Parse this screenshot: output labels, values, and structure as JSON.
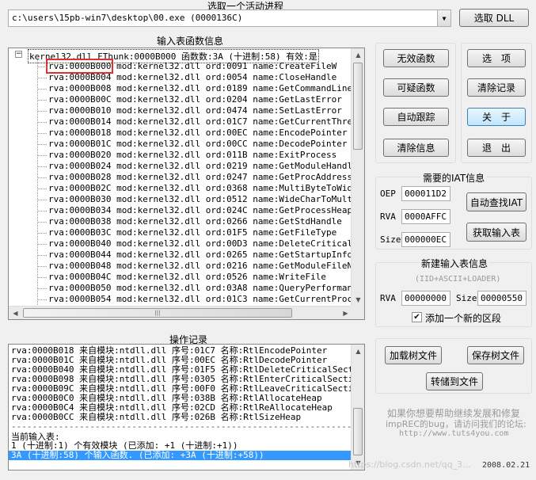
{
  "process_section": {
    "title": "选取一个活动进程",
    "selected_process": "c:\\users\\15pb-win7\\desktop\\00.exe (0000136C)",
    "select_dll_label": "选取 DLL"
  },
  "import_section": {
    "title": "输入表函数信息",
    "tree_expand_glyph": "−",
    "root_label": "kernel32.dll FThunk:0000B000 函数数:3A (十进制:58) 有效:是",
    "highlighted_rva": "rva:0000B000",
    "rows": [
      {
        "rva": "rva:0000B000",
        "rest": " mod:kernel32.dll ord:0091 name:CreateFileW"
      },
      {
        "rva": "rva:0000B004",
        "rest": " mod:kernel32.dll ord:0054 name:CloseHandle"
      },
      {
        "rva": "rva:0000B008",
        "rest": " mod:kernel32.dll ord:0189 name:GetCommandLineW"
      },
      {
        "rva": "rva:0000B00C",
        "rest": " mod:kernel32.dll ord:0204 name:GetLastError"
      },
      {
        "rva": "rva:0000B010",
        "rest": " mod:kernel32.dll ord:0474 name:SetLastError"
      },
      {
        "rva": "rva:0000B014",
        "rest": " mod:kernel32.dll ord:01C7 name:GetCurrentThreadId"
      },
      {
        "rva": "rva:0000B018",
        "rest": " mod:kernel32.dll ord:00EC name:EncodePointer"
      },
      {
        "rva": "rva:0000B01C",
        "rest": " mod:kernel32.dll ord:00CC name:DecodePointer"
      },
      {
        "rva": "rva:0000B020",
        "rest": " mod:kernel32.dll ord:011B name:ExitProcess"
      },
      {
        "rva": "rva:0000B024",
        "rest": " mod:kernel32.dll ord:0219 name:GetModuleHandleExW"
      },
      {
        "rva": "rva:0000B028",
        "rest": " mod:kernel32.dll ord:0247 name:GetProcAddress"
      },
      {
        "rva": "rva:0000B02C",
        "rest": " mod:kernel32.dll ord:0368 name:MultiByteToWideChar"
      },
      {
        "rva": "rva:0000B030",
        "rest": " mod:kernel32.dll ord:0512 name:WideCharToMultiByte"
      },
      {
        "rva": "rva:0000B034",
        "rest": " mod:kernel32.dll ord:024C name:GetProcessHeap"
      },
      {
        "rva": "rva:0000B038",
        "rest": " mod:kernel32.dll ord:0266 name:GetStdHandle"
      },
      {
        "rva": "rva:0000B03C",
        "rest": " mod:kernel32.dll ord:01F5 name:GetFileType"
      },
      {
        "rva": "rva:0000B040",
        "rest": " mod:kernel32.dll ord:00D3 name:DeleteCriticalSection"
      },
      {
        "rva": "rva:0000B044",
        "rest": " mod:kernel32.dll ord:0265 name:GetStartupInfoW"
      },
      {
        "rva": "rva:0000B048",
        "rest": " mod:kernel32.dll ord:0216 name:GetModuleFileNameW"
      },
      {
        "rva": "rva:0000B04C",
        "rest": " mod:kernel32.dll ord:0526 name:WriteFile"
      },
      {
        "rva": "rva:0000B050",
        "rest": " mod:kernel32.dll ord:03A8 name:QueryPerformanceCount"
      },
      {
        "rva": "rva:0000B054",
        "rest": " mod:kernel32.dll ord:01C3 name:GetCurrentProcessId"
      }
    ],
    "scroll_thumb_glyph": "|||"
  },
  "buttons": {
    "invalid_funcs": "无效函数",
    "suspicious_funcs": "可疑函数",
    "auto_trace": "自动跟踪",
    "clear_info": "清除信息",
    "options": "选　项",
    "clear_log": "清除记录",
    "about": "关　于",
    "exit": "退　出"
  },
  "iat_section": {
    "title": "需要的IAT信息",
    "oep_label": "OEP",
    "oep_value": "000011D2",
    "rva_label": "RVA",
    "rva_value": "0000AFFC",
    "size_label": "Size",
    "size_value": "000000EC",
    "auto_find_label": "自动查找IAT",
    "get_imports_label": "获取输入表"
  },
  "new_import_section": {
    "title": "新建输入表信息",
    "subtitle": "(IID+ASCII+LOADER)",
    "rva_label": "RVA",
    "rva_value": "00000000",
    "size_label": "Size",
    "size_value": "00000550",
    "add_section_checked": true,
    "check_glyph": "✔",
    "add_section_label": "添加一个新的区段"
  },
  "log_section": {
    "title": "操作记录",
    "rows": [
      "rva:0000B018 来自模块:ntdll.dll 序号:01C7 名称:RtlEncodePointer",
      "rva:0000B01C 来自模块:ntdll.dll 序号:00EC 名称:RtlDecodePointer",
      "rva:0000B040 来自模块:ntdll.dll 序号:01F5 名称:RtlDeleteCriticalSection",
      "rva:0000B098 来自模块:ntdll.dll 序号:0305 名称:RtlEnterCriticalSection",
      "rva:0000B09C 来自模块:ntdll.dll 序号:00F0 名称:RtlLeaveCriticalSection",
      "rva:0000B0C0 来自模块:ntdll.dll 序号:038B 名称:RtlAllocateHeap",
      "rva:0000B0C4 来自模块:ntdll.dll 序号:02CD 名称:RtlReAllocateHeap",
      "rva:0000B0CC 来自模块:ntdll.dll 序号:026B 名称:RtlSizeHeap"
    ],
    "divider": "------------------------------------------------------------------",
    "summary_title": "当前输入表:",
    "summary_line1": "1 (十进制:1) 个有效模块 (已添加: +1 (十进制:+1))",
    "summary_line2": "3A (十进制:58) 个输入函数. (已添加: +3A (十进制:+58))"
  },
  "file_buttons": {
    "load_tree": "加载树文件",
    "save_tree": "保存树文件",
    "dump_to_file": "转储到文件"
  },
  "help": {
    "line1": "如果你想要帮助继续发展和修复",
    "line2": "impREC的bug，请访问我们的论坛:",
    "line3": "http://www.tuts4you.com"
  },
  "footer": {
    "date": "2008.02.21",
    "watermark": "https://blog.csdn.net/qq_3..."
  }
}
